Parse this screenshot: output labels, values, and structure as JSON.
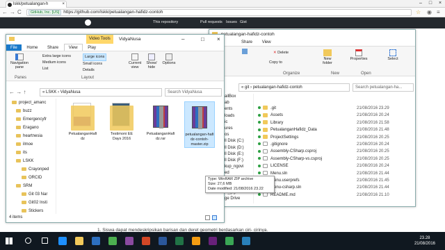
{
  "browser": {
    "tab_title": "lskk/petualangan-h",
    "tab_close": "×",
    "win_min": "–",
    "win_max": "□",
    "win_close": "×",
    "back": "←",
    "forward": "→",
    "reload": "C",
    "cert_badge": "GitHub, Inc. [US]",
    "url": "https://github.com/lskk/petualangan-hafidz-contoh"
  },
  "github": {
    "search_label": "This repository",
    "pull_requests": "Pull requests",
    "issues": "Issues",
    "gist": "Gist"
  },
  "doc_text": "1. Siswa dapat mendeskripsikan barisan dan deret geometri berdasarkan ciri- cirinya.",
  "explorer_left": {
    "ribbon_context": "Video Tools",
    "title": "VidyaNusa",
    "tabs": [
      "File",
      "Home",
      "Share",
      "View",
      "Play"
    ],
    "ribbon": {
      "navigation_pane": "Navigation pane",
      "panes": "Panes",
      "extra_large": "Extra large icons",
      "large_icons": "Large icons",
      "medium_icons": "Medium icons",
      "small_icons": "Small icons",
      "list": "List",
      "details": "Details",
      "layout": "Layout",
      "current_view": "Current view",
      "show_hide": "Show/ hide",
      "options": "Options"
    },
    "address": [
      "LSKK",
      "VidyaNusa"
    ],
    "search_placeholder": "Search VidyaNusa",
    "nav_items": [
      "project_amanc",
      "buzz",
      "Emergencyfr",
      "Eragano",
      "heartnesia",
      "ilmoe",
      "its",
      "LSKK",
      "Crayonped",
      "ORCID",
      "SRM",
      "Git 03 Nar",
      "Git02 Insti",
      "Stickers",
      "VidyaNusa"
    ],
    "files": [
      {
        "name": "PetualanganHafi dz"
      },
      {
        "name": "Testimoni EE Days 2016"
      },
      {
        "name": "PetualanganHafi dz.rar"
      },
      {
        "name": "petualangan-hafi dz-contoh-master.zip"
      }
    ],
    "tooltip": {
      "type": "Type: WinRAR ZIP archive",
      "size": "Size: 27,6 MB",
      "modified": "Date modified: 21/08/2016 23.22"
    },
    "status": "4 items"
  },
  "explorer_right": {
    "title": "petualangan-hafidz-contoh",
    "tabs": [
      "Share",
      "View"
    ],
    "ribbon": {
      "delete": "Delete",
      "copy_to": "Copy to",
      "new_folder": "New folder",
      "properties": "Properties",
      "select": "Select",
      "organize": "Organize",
      "new": "New",
      "open": "Open"
    },
    "address": [
      "git",
      "petualangan-hafidz-contoh"
    ],
    "search_placeholder": "Search petualangan-ha...",
    "nav_items": [
      "ailBox",
      "ab",
      "ents",
      "loads",
      "ic",
      "ures",
      "os",
      "ll Disk (C:)",
      "ll Disk (D:)",
      "ll Disk (E:)",
      "ll Disk (F:)",
      "kup_ngovi",
      "ed",
      "ojects",
      "ites",
      "ic_gigasti",
      "ge Drive"
    ],
    "files": [
      {
        "name": ".git",
        "date": "21/08/2016 23.29",
        "kind": "folder"
      },
      {
        "name": "Assets",
        "date": "21/08/2016 20.24",
        "kind": "folder"
      },
      {
        "name": "Library",
        "date": "21/08/2016 21.58",
        "kind": "folder"
      },
      {
        "name": "PetualanganHafidz_Data",
        "date": "21/08/2016 21.48",
        "kind": "folder"
      },
      {
        "name": "ProjectSettings",
        "date": "21/08/2016 20.25",
        "kind": "folder"
      },
      {
        "name": ".gitignore",
        "date": "21/08/2016 20.24",
        "kind": "file"
      },
      {
        "name": "Assembly-CSharp.csproj",
        "date": "21/08/2016 20.25",
        "kind": "file"
      },
      {
        "name": "Assembly-CSharp-vs.csproj",
        "date": "21/08/2016 20.25",
        "kind": "file"
      },
      {
        "name": "LICENSE",
        "date": "21/08/2016 20.24",
        "kind": "file"
      },
      {
        "name": "Menu.sln",
        "date": "21/08/2016 21.44",
        "kind": "file"
      },
      {
        "name": "Menu.userprefs",
        "date": "21/08/2016 21.45",
        "kind": "file"
      },
      {
        "name": "Menu-csharp.sln",
        "date": "21/08/2016 21.44",
        "kind": "file"
      },
      {
        "name": "README.md",
        "date": "21/08/2016 21.10",
        "kind": "file"
      }
    ]
  },
  "taskbar": {
    "time": "23.28",
    "date": "21/08/2016"
  },
  "colors": {
    "accent": "#1979ca",
    "github_header": "#24292e",
    "folder": "#f1c95b",
    "selection": "#cce8ff",
    "taskbar": "#101820"
  }
}
